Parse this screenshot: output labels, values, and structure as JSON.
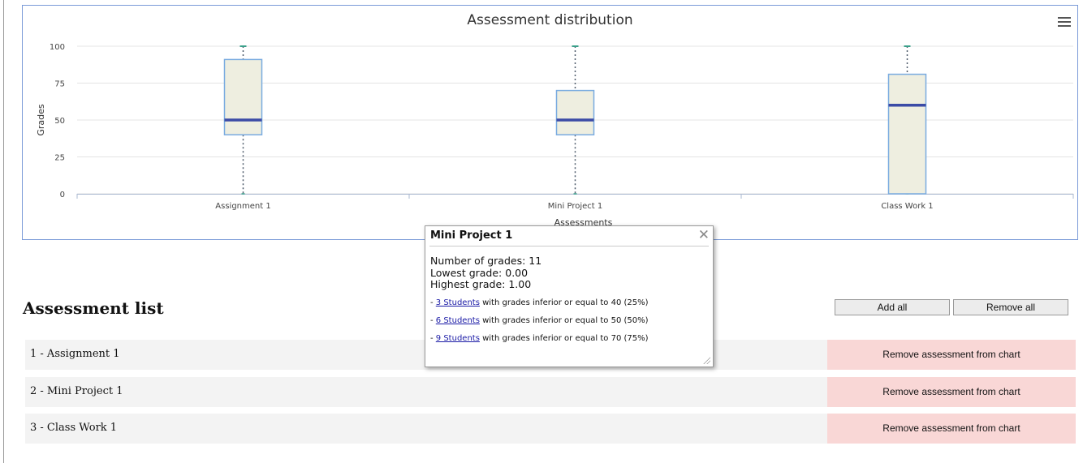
{
  "chart_data": {
    "type": "boxplot",
    "title": "Assessment distribution",
    "xlabel": "Assessments",
    "ylabel": "Grades",
    "ylim": [
      0,
      100
    ],
    "yticks": [
      0,
      25,
      50,
      75,
      100
    ],
    "grid": true,
    "categories": [
      "Assignment 1",
      "Mini Project 1",
      "Class Work 1"
    ],
    "boxes": [
      {
        "min": 0,
        "q1": 40,
        "median": 50,
        "q3": 91,
        "max": 100
      },
      {
        "min": 0,
        "q1": 40,
        "median": 50,
        "q3": 70,
        "max": 100
      },
      {
        "min": 0,
        "q1": 0,
        "median": 60,
        "q3": 81,
        "max": 100
      }
    ],
    "colors": {
      "box_fill": "#eeeee0",
      "box_stroke": "#79abe0",
      "median": "#3b4ba6",
      "whisker": "#4f5b6b",
      "whisker_cap": "#3aa08a",
      "grid": "#e4e4e4"
    }
  },
  "menu": {
    "icon": "hamburger-menu-icon"
  },
  "popup": {
    "title": "Mini Project 1",
    "close_glyph": "✕",
    "stats": [
      "Number of grades: 11",
      "Lowest grade: 0.00",
      "Highest grade: 1.00"
    ],
    "links": [
      {
        "prefix": "- ",
        "link": "3 Students",
        "suffix": " with grades inferior or equal to 40 (25%)"
      },
      {
        "prefix": "- ",
        "link": "6 Students",
        "suffix": " with grades inferior or equal to 50 (50%)"
      },
      {
        "prefix": "- ",
        "link": "9 Students",
        "suffix": " with grades inferior or equal to 70 (75%)"
      }
    ]
  },
  "list": {
    "heading": "Assessment list",
    "add_all": "Add all",
    "remove_all": "Remove all",
    "items": [
      {
        "label": "1 - Assignment 1",
        "action": "Remove assessment from chart"
      },
      {
        "label": "2 - Mini Project 1",
        "action": "Remove assessment from chart"
      },
      {
        "label": "3 - Class Work 1",
        "action": "Remove assessment from chart"
      }
    ]
  }
}
